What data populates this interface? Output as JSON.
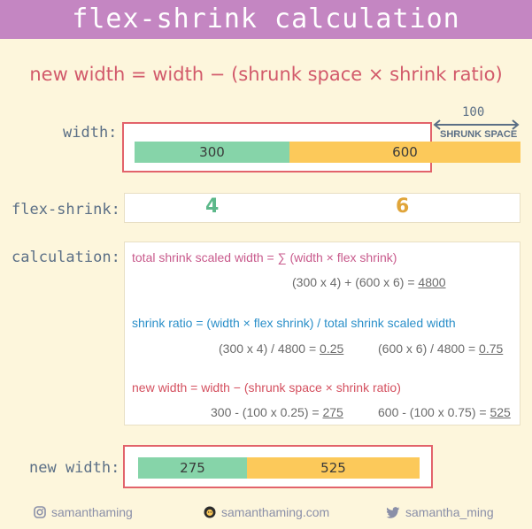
{
  "header": {
    "title": "flex-shrink calculation"
  },
  "formula": "new width  =  width  −  (shrunk space  ×  shrink ratio)",
  "labels": {
    "width": "width:",
    "flex_shrink": "flex-shrink:",
    "calculation": "calculation:",
    "new_width": "new width:"
  },
  "width_row": {
    "item1": "300",
    "item2": "600",
    "shrunk_value": "100",
    "shrunk_label": "SHRUNK SPACE"
  },
  "flex_shrink_row": {
    "item1": "4",
    "item2": "6"
  },
  "calculation": {
    "total_label": "total shrink scaled width  =  ∑ (width  ×  flex shrink)",
    "total_expr": "(300 x 4) + (600 x 6) = ",
    "total_result": "4800",
    "ratio_label": "shrink ratio  =  (width  ×  flex shrink)  /  total shrink scaled width",
    "ratio_expr1": "(300 x 4) / 4800 = ",
    "ratio_result1": "0.25",
    "ratio_expr2": "(600 x 6) / 4800 = ",
    "ratio_result2": "0.75",
    "new_label": "new width  =  width  −  (shrunk space  ×  shrink ratio)",
    "new_expr1": "300 - (100 x 0.25) = ",
    "new_result1": "275",
    "new_expr2": "600 - (100 x 0.75) = ",
    "new_result2": "525"
  },
  "new_width_row": {
    "item1": "275",
    "item2": "525"
  },
  "footer": {
    "instagram": "samanthaming",
    "website": "samanthaming.com",
    "twitter": "samantha_ming"
  },
  "colors": {
    "header_bg": "#c486c2",
    "background": "#fdf6dc",
    "green": "#86d4a9",
    "yellow": "#fcc95a",
    "frame_red": "#e2636b",
    "num_green": "#5cb88a",
    "num_yellow": "#e0a53a"
  },
  "icons": [
    "instagram-icon",
    "website-icon",
    "twitter-icon",
    "shrunk-arrow-icon"
  ]
}
